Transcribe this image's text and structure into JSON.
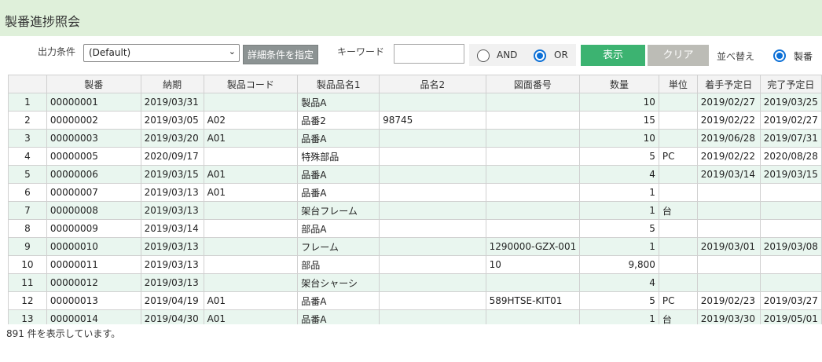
{
  "page": {
    "title": "製番進捗照会"
  },
  "toolbar": {
    "output_condition_label": "出力条件",
    "output_condition_value": "(Default)",
    "detail_button": "詳細条件を指定",
    "keyword_label": "キーワード",
    "keyword_value": "",
    "and_label": "AND",
    "or_label": "OR",
    "logic_selected": "OR",
    "show_button": "表示",
    "clear_button": "クリア",
    "sort_label": "並べ替え",
    "sort_option": "製番"
  },
  "table": {
    "columns": [
      "",
      "製番",
      "納期",
      "製品コード",
      "製品品名1",
      "品名2",
      "図面番号",
      "数量",
      "単位",
      "着手予定日",
      "完了予定日"
    ],
    "rows": [
      [
        "1",
        "00000001",
        "2019/03/31",
        "",
        "製品A",
        "",
        "",
        "10",
        "",
        "2019/02/27",
        "2019/03/25"
      ],
      [
        "2",
        "00000002",
        "2019/03/05",
        "A02",
        "品番2",
        "98745",
        "",
        "15",
        "",
        "2019/02/22",
        "2019/02/27"
      ],
      [
        "3",
        "00000003",
        "2019/03/20",
        "A01",
        "品番A",
        "",
        "",
        "10",
        "",
        "2019/06/28",
        "2019/07/31"
      ],
      [
        "4",
        "00000005",
        "2020/09/17",
        "",
        "特殊部品",
        "",
        "",
        "5",
        "PC",
        "2019/02/22",
        "2020/08/28"
      ],
      [
        "5",
        "00000006",
        "2019/03/15",
        "A01",
        "品番A",
        "",
        "",
        "4",
        "",
        "2019/03/14",
        "2019/03/15"
      ],
      [
        "6",
        "00000007",
        "2019/03/13",
        "A01",
        "品番A",
        "",
        "",
        "1",
        "",
        "",
        ""
      ],
      [
        "7",
        "00000008",
        "2019/03/13",
        "",
        "架台フレーム",
        "",
        "",
        "1",
        "台",
        "",
        ""
      ],
      [
        "8",
        "00000009",
        "2019/03/14",
        "",
        "部品A",
        "",
        "",
        "5",
        "",
        "",
        ""
      ],
      [
        "9",
        "00000010",
        "2019/03/13",
        "",
        "フレーム",
        "",
        "1290000-GZX-001",
        "1",
        "",
        "2019/03/01",
        "2019/03/08"
      ],
      [
        "10",
        "00000011",
        "2019/03/13",
        "",
        "部品",
        "",
        "10",
        "9,800",
        "",
        "",
        ""
      ],
      [
        "11",
        "00000012",
        "2019/03/13",
        "",
        "架台シャーシ",
        "",
        "",
        "4",
        "",
        "",
        ""
      ],
      [
        "12",
        "00000013",
        "2019/04/19",
        "A01",
        "品番A",
        "",
        "589HTSE-KIT01",
        "5",
        "PC",
        "2019/02/23",
        "2019/03/27"
      ],
      [
        "13",
        "00000014",
        "2019/04/30",
        "A01",
        "品番A",
        "",
        "",
        "1",
        "台",
        "2019/03/30",
        "2019/05/01"
      ]
    ]
  },
  "footer": {
    "status": "891 件を表示しています。"
  }
}
